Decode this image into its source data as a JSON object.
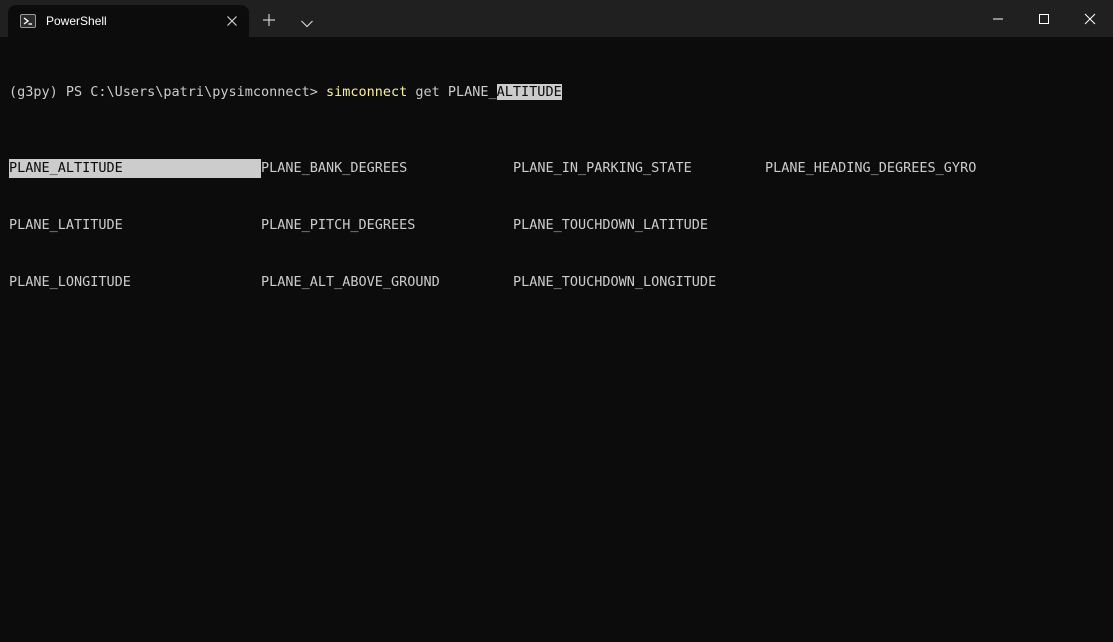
{
  "window": {
    "tab": {
      "title": "PowerShell",
      "icon": "powershell-icon"
    },
    "controls": {
      "new_tab_icon": "plus-icon",
      "dropdown_icon": "chevron-down-icon",
      "minimize_icon": "minimize-icon",
      "maximize_icon": "maximize-icon",
      "close_icon": "close-icon"
    }
  },
  "terminal": {
    "prompt": "(g3py) PS C:\\Users\\patri\\pysimconnect> ",
    "command": "simconnect",
    "args_prefix": " get PLANE_",
    "args_selected": "ALTITUDE",
    "completions": [
      [
        "PLANE_ALTITUDE",
        "PLANE_BANK_DEGREES",
        "PLANE_IN_PARKING_STATE",
        "PLANE_HEADING_DEGREES_GYRO"
      ],
      [
        "PLANE_LATITUDE",
        "PLANE_PITCH_DEGREES",
        "PLANE_TOUCHDOWN_LATITUDE",
        ""
      ],
      [
        "PLANE_LONGITUDE",
        "PLANE_ALT_ABOVE_GROUND",
        "PLANE_TOUCHDOWN_LONGITUDE",
        ""
      ]
    ]
  },
  "colors": {
    "background": "#0c0c0c",
    "titlebar": "#202020",
    "text": "#cccccc",
    "command": "#f9f1a5",
    "selection": "#cccccc"
  }
}
